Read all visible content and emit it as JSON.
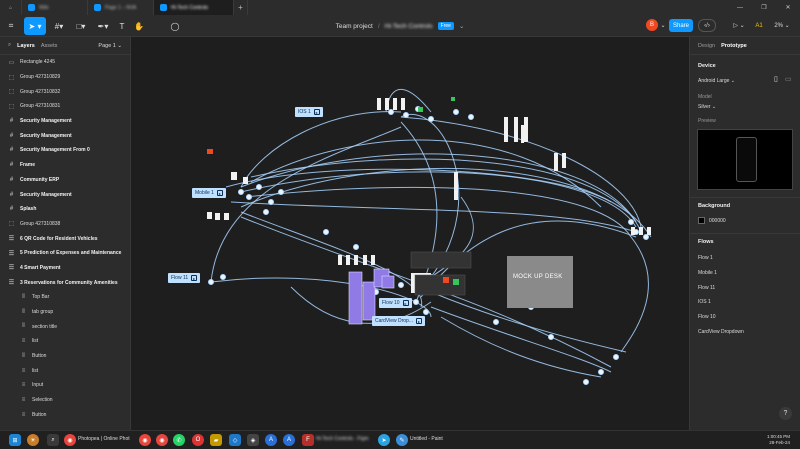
{
  "browser": {
    "tabs": [
      {
        "label": "Wiki",
        "blurred": true
      },
      {
        "label": "Page 1 – NVA",
        "blurred": true
      },
      {
        "label": "Hi-Tech Controls",
        "blurred": true,
        "active": true
      }
    ],
    "new_tab": "+"
  },
  "toolbar": {
    "project": "Team project",
    "separator": "/",
    "file_name": "Hi-Tech Controls",
    "plan_badge": "Free",
    "avatar_letter": "B",
    "share_label": "Share",
    "zoom": "2%",
    "ai_label": "A1"
  },
  "left_panel": {
    "tab_layers": "Layers",
    "tab_assets": "Assets",
    "page_selector": "Page 1",
    "layers": [
      {
        "label": "Rectangle 4245",
        "icon": "rect",
        "bold": false,
        "child": false
      },
      {
        "label": "Group 427310829",
        "icon": "group",
        "bold": false,
        "child": false
      },
      {
        "label": "Group 427310832",
        "icon": "group",
        "bold": false,
        "child": false
      },
      {
        "label": "Group 427310831",
        "icon": "group",
        "bold": false,
        "child": false
      },
      {
        "label": "Security Management",
        "icon": "frame",
        "bold": true,
        "child": false
      },
      {
        "label": "Security Management",
        "icon": "frame",
        "bold": true,
        "child": false
      },
      {
        "label": "Security Management From 0",
        "icon": "frame",
        "bold": true,
        "child": false
      },
      {
        "label": "Frame",
        "icon": "frame",
        "bold": true,
        "child": false
      },
      {
        "label": "Community ERP",
        "icon": "frame",
        "bold": true,
        "child": false
      },
      {
        "label": "Security Management",
        "icon": "frame",
        "bold": true,
        "child": false
      },
      {
        "label": "Splash",
        "icon": "frame",
        "bold": true,
        "child": false
      },
      {
        "label": "Group 427310838",
        "icon": "group",
        "bold": false,
        "child": false
      },
      {
        "label": "6 QR Code for Resident Vehicles",
        "icon": "autolayout",
        "bold": true,
        "child": false
      },
      {
        "label": "5 Prediction of Expenses and Maintenance",
        "icon": "autolayout",
        "bold": true,
        "child": false
      },
      {
        "label": "4 Smart Payment",
        "icon": "autolayout",
        "bold": true,
        "child": false
      },
      {
        "label": "3 Reservations for Community Amenities",
        "icon": "autolayout",
        "bold": true,
        "child": false
      },
      {
        "label": "Top Bar",
        "icon": "col",
        "bold": false,
        "child": true
      },
      {
        "label": "tab group",
        "icon": "col",
        "bold": false,
        "child": true
      },
      {
        "label": "section title",
        "icon": "col",
        "bold": false,
        "child": true
      },
      {
        "label": "list",
        "icon": "rows",
        "bold": false,
        "child": true
      },
      {
        "label": "Button",
        "icon": "col",
        "bold": false,
        "child": true
      },
      {
        "label": "list",
        "icon": "rows",
        "bold": false,
        "child": true
      },
      {
        "label": "Input",
        "icon": "rows",
        "bold": false,
        "child": true
      },
      {
        "label": "Selection",
        "icon": "rows",
        "bold": false,
        "child": true
      },
      {
        "label": "Button",
        "icon": "rows",
        "bold": false,
        "child": true
      }
    ]
  },
  "right_panel": {
    "tab_design": "Design",
    "tab_prototype": "Prototype",
    "device_title": "Device",
    "device_value": "Android Large",
    "model_label": "Model",
    "model_value": "Silver",
    "preview_label": "Preview",
    "background_title": "Background",
    "background_value": "000000",
    "background_color": "#000000",
    "flows_title": "Flows",
    "flows": [
      "Flow 1",
      "Mobile 1",
      "Flow 11",
      "IOS 1",
      "Flow 10",
      "CardView Dropdown"
    ],
    "help": "?"
  },
  "canvas": {
    "flow_labels": [
      "IOS 1",
      "Mobile 1",
      "Flow 11",
      "Flow 10",
      "CardView Drop..."
    ],
    "mockup_text": "MOCK UP DESK",
    "accent_color": "#bfe1ff",
    "connector_color": "#a8d4ff"
  },
  "taskbar": {
    "photopea_label": "Photopea | Online Phot",
    "figma_label": "Hi-Tech Controls - Figm",
    "paint_label": "Untitled - Paint",
    "time": "1:00:45 PM",
    "date": "28-Feb-24"
  }
}
